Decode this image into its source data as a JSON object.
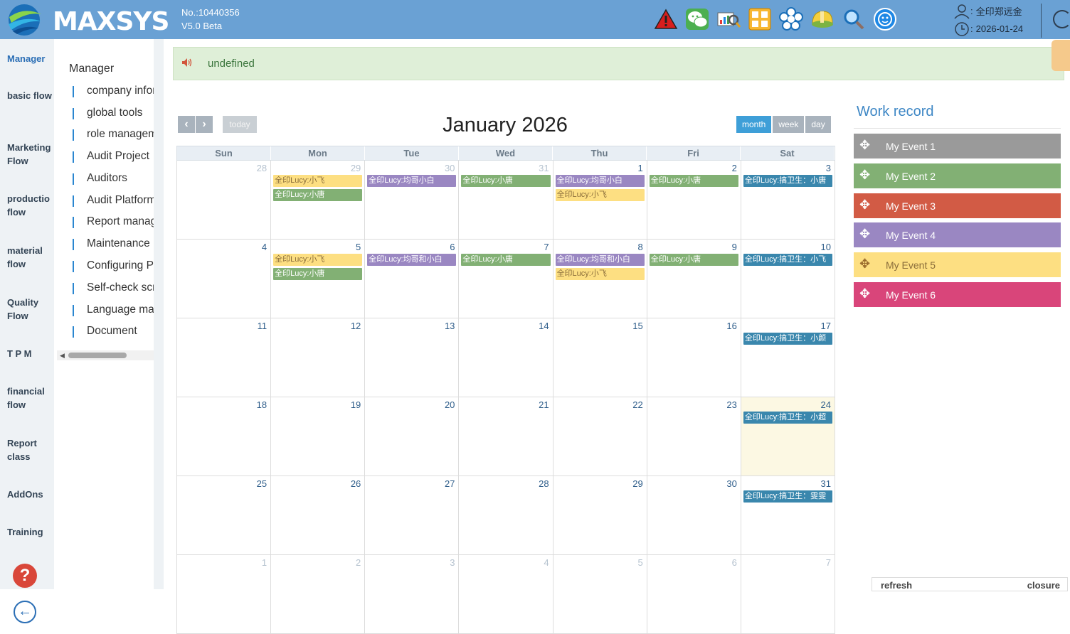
{
  "header": {
    "brand": "MAXSYS",
    "number": "No.:10440356",
    "version": "V5.0 Beta",
    "icons": [
      "warning-icon",
      "wechat-icon",
      "report-search-icon",
      "calculator-icon",
      "flower-icon",
      "helmet-icon",
      "magnifier-icon",
      "support-icon"
    ],
    "user_label": ":",
    "user_name": "全印郑远金",
    "date_label": ":",
    "date": "2026-01-24"
  },
  "leftnav": {
    "items": [
      {
        "label": "Manager",
        "active": true
      },
      {
        "label": "basic flow"
      },
      {
        "label": "Marketing Flow"
      },
      {
        "label": "productio flow"
      },
      {
        "label": "material flow"
      },
      {
        "label": "Quality Flow"
      },
      {
        "label": "T P M"
      },
      {
        "label": "financial flow"
      },
      {
        "label": "Report class"
      },
      {
        "label": "AddOns"
      },
      {
        "label": "Training"
      }
    ],
    "help": "?",
    "back": "←"
  },
  "submenu": {
    "title": "Manager",
    "items": [
      "company infor",
      "global tools",
      "role managem",
      "Audit Project",
      "Auditors",
      "Audit Platform",
      "Report manage",
      "Maintenance lo",
      "Configuring Pa",
      "Self-check scrip",
      "Language man",
      "Document"
    ]
  },
  "notice": {
    "text": "undefined"
  },
  "calendar": {
    "title": "January 2026",
    "today_label": "today",
    "prev": "‹",
    "next": "›",
    "views": [
      "month",
      "week",
      "day"
    ],
    "active_view": "month",
    "days_of_week": [
      "Sun",
      "Mon",
      "Tue",
      "Wed",
      "Thu",
      "Fri",
      "Sat"
    ],
    "weeks": [
      [
        {
          "n": "28",
          "other": true
        },
        {
          "n": "29",
          "other": true,
          "events": [
            {
              "t": "全印Lucy:小飞",
              "c": "yellow"
            },
            {
              "t": "全印Lucy:小唐",
              "c": "green"
            }
          ]
        },
        {
          "n": "30",
          "other": true,
          "events": [
            {
              "t": "全印Lucy:均哥小白",
              "c": "purple"
            }
          ]
        },
        {
          "n": "31",
          "other": true,
          "events": [
            {
              "t": "全印Lucy:小唐",
              "c": "green"
            }
          ]
        },
        {
          "n": "1",
          "events": [
            {
              "t": "全印Lucy:均哥小白",
              "c": "purple"
            },
            {
              "t": "全印Lucy:小飞",
              "c": "yellow"
            }
          ]
        },
        {
          "n": "2",
          "events": [
            {
              "t": "全印Lucy:小唐",
              "c": "green"
            }
          ]
        },
        {
          "n": "3",
          "events": [
            {
              "t": "全印Lucy:搞卫生：小唐",
              "c": "blue"
            }
          ]
        }
      ],
      [
        {
          "n": "4"
        },
        {
          "n": "5",
          "events": [
            {
              "t": "全印Lucy:小飞",
              "c": "yellow"
            },
            {
              "t": "全印Lucy:小唐",
              "c": "green"
            }
          ]
        },
        {
          "n": "6",
          "events": [
            {
              "t": "全印Lucy:均哥和小白",
              "c": "purple"
            }
          ]
        },
        {
          "n": "7",
          "events": [
            {
              "t": "全印Lucy:小唐",
              "c": "green"
            }
          ]
        },
        {
          "n": "8",
          "events": [
            {
              "t": "全印Lucy:均哥和小白",
              "c": "purple"
            },
            {
              "t": "全印Lucy:小飞",
              "c": "yellow"
            }
          ]
        },
        {
          "n": "9",
          "events": [
            {
              "t": "全印Lucy:小唐",
              "c": "green"
            }
          ]
        },
        {
          "n": "10",
          "events": [
            {
              "t": "全印Lucy:搞卫生：小飞",
              "c": "blue"
            }
          ]
        }
      ],
      [
        {
          "n": "11"
        },
        {
          "n": "12"
        },
        {
          "n": "13"
        },
        {
          "n": "14"
        },
        {
          "n": "15"
        },
        {
          "n": "16"
        },
        {
          "n": "17",
          "events": [
            {
              "t": "全印Lucy:搞卫生：小颜",
              "c": "blue"
            }
          ]
        }
      ],
      [
        {
          "n": "18"
        },
        {
          "n": "19"
        },
        {
          "n": "20"
        },
        {
          "n": "21"
        },
        {
          "n": "22"
        },
        {
          "n": "23"
        },
        {
          "n": "24",
          "today": true,
          "events": [
            {
              "t": "全印Lucy:搞卫生：小超",
              "c": "blue"
            }
          ]
        }
      ],
      [
        {
          "n": "25"
        },
        {
          "n": "26"
        },
        {
          "n": "27"
        },
        {
          "n": "28"
        },
        {
          "n": "29"
        },
        {
          "n": "30"
        },
        {
          "n": "31",
          "events": [
            {
              "t": "全印Lucy:搞卫生：雯雯",
              "c": "blue"
            }
          ]
        }
      ],
      [
        {
          "n": "1",
          "other": true
        },
        {
          "n": "2",
          "other": true
        },
        {
          "n": "3",
          "other": true
        },
        {
          "n": "4",
          "other": true
        },
        {
          "n": "5",
          "other": true
        },
        {
          "n": "6",
          "other": true
        },
        {
          "n": "7",
          "other": true
        }
      ]
    ]
  },
  "work_record": {
    "title": "Work record",
    "events": [
      {
        "label": "My Event 1",
        "color": "#9a9a9a"
      },
      {
        "label": "My Event 2",
        "color": "#82b074"
      },
      {
        "label": "My Event 3",
        "color": "#d25b45"
      },
      {
        "label": "My Event 4",
        "color": "#9a87c2"
      },
      {
        "label": "My Event 5",
        "color": "#fddf82",
        "dark": true
      },
      {
        "label": "My Event 6",
        "color": "#d9457a"
      }
    ]
  },
  "footer": {
    "refresh": "refresh",
    "closure": "closure"
  },
  "colors": {
    "header": "#6aa1d4",
    "yellow": "#fddf82",
    "green": "#82b074",
    "purple": "#9a87c2",
    "blue": "#3a87ad",
    "today": "#fcf8e3"
  }
}
